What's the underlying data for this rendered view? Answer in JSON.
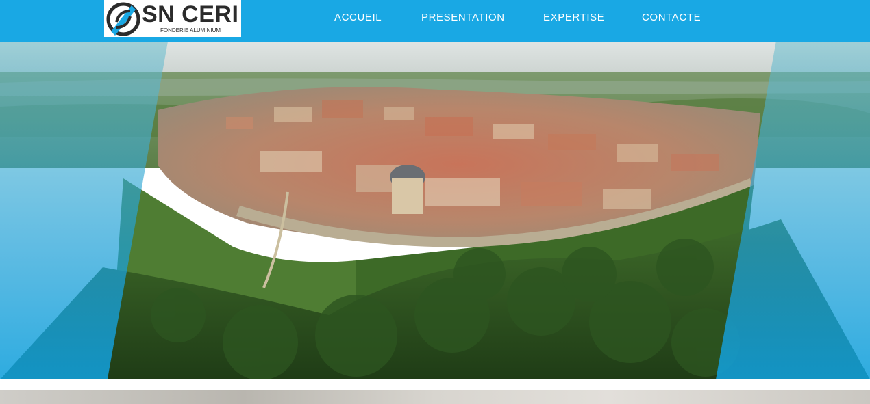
{
  "brand": {
    "name_main": "SN CERI",
    "tagline": "FONDERIE ALUMINIUM",
    "accent_color": "#19a8e4",
    "dark_color": "#2b2b2b"
  },
  "nav": {
    "items": [
      {
        "label": "ACCUEIL"
      },
      {
        "label": "PRESENTATION"
      },
      {
        "label": "EXPERTISE"
      },
      {
        "label": "CONTACTE"
      }
    ]
  },
  "hero": {
    "image": "aerial-view-hilltop-walled-town",
    "overlay_color": "#19a8e4"
  },
  "colors": {
    "header_bg": "#19a8e4",
    "nav_text": "#ffffff"
  }
}
